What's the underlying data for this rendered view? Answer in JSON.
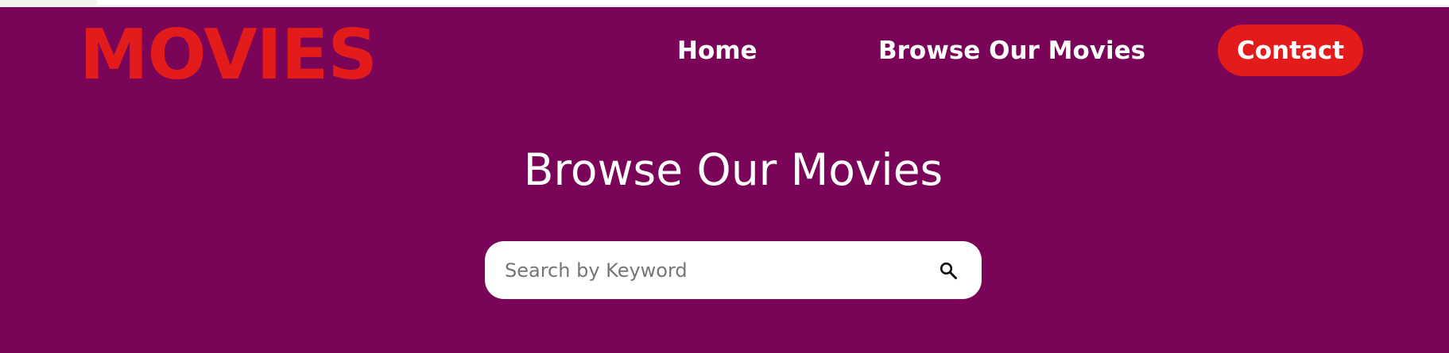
{
  "brand": {
    "logo_text": "MOVIES"
  },
  "nav": {
    "items": [
      {
        "label": "Home"
      },
      {
        "label": "Browse Our Movies"
      }
    ],
    "contact_label": "Contact"
  },
  "main": {
    "title": "Browse Our Movies",
    "search": {
      "placeholder": "Search by Keyword",
      "value": "",
      "icon": "search-icon"
    }
  },
  "colors": {
    "hero_background": "#7a0558",
    "accent_red": "#e31b1b",
    "text_white": "#ffffff"
  }
}
